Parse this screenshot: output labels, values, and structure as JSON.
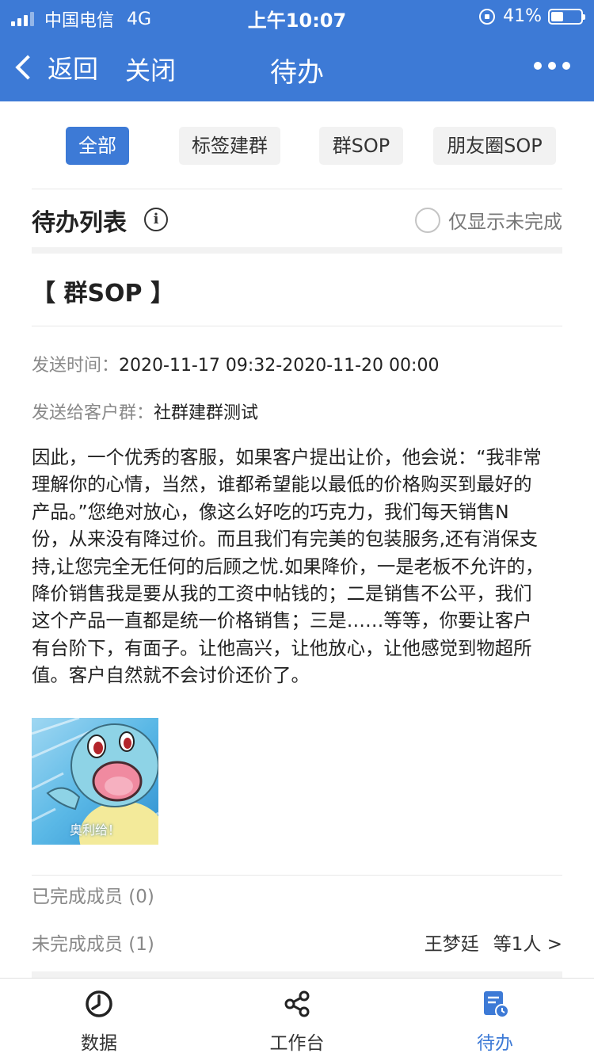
{
  "status_bar": {
    "carrier": "中国电信",
    "network": "4G",
    "time": "上午10:07",
    "battery": "41%",
    "battery_level": 0.41
  },
  "nav": {
    "back_label": "返回",
    "close_label": "关闭",
    "title": "待办"
  },
  "filters": [
    {
      "label": "全部",
      "active": true
    },
    {
      "label": "标签建群",
      "active": false
    },
    {
      "label": "群SOP",
      "active": false
    },
    {
      "label": "朋友圈SOP",
      "active": false
    }
  ],
  "list": {
    "title": "待办列表",
    "info_glyph": "i",
    "only_incomplete_label": "仅显示未完成"
  },
  "task": {
    "title": "【 群SOP 】",
    "send_time_label": "发送时间：",
    "send_time_value": "2020-11-17 09:32-2020-11-20 00:00",
    "send_to_label": "发送给客户群：",
    "send_to_value": "社群建群测试",
    "content_lines": [
      "因此，一个优秀的客服，如果客户提出让价，他会说：“我非常",
      "理解你的心情，当然，谁都希望能以最低的价格购买到最好的",
      "产品。”您绝对放心，像这么好吃的巧克力，我们每天销售N",
      "份，从来没有降过价。而且我们有完美的包装服务,还有消保支",
      "持,让您完全无任何的后顾之忧.如果降价，一是老板不允许的，",
      "降价销售我是要从我的工资中帖钱的；二是销售不公平，我们",
      "这个产品一直都是统一价格销售；三是……等等，你要让客户",
      "有台阶下，有面子。让他高兴，让他放心，让他感觉到物超所",
      "值。客户自然就不会讨价还价了。"
    ],
    "image_caption": "奥利给！",
    "completed_label": "已完成成员 (0)",
    "incomplete_label": "未完成成员 (1)",
    "incomplete_member": "王梦廷",
    "incomplete_more": "等1人 >"
  },
  "tabbar": [
    {
      "label": "数据",
      "icon": "clock-icon",
      "active": false
    },
    {
      "label": "工作台",
      "icon": "share-icon",
      "active": false
    },
    {
      "label": "待办",
      "icon": "todo-doc-icon",
      "active": true
    }
  ],
  "colors": {
    "primary": "#3d7ad6",
    "chip_bg": "#f2f2f2",
    "muted_text": "#888888"
  }
}
